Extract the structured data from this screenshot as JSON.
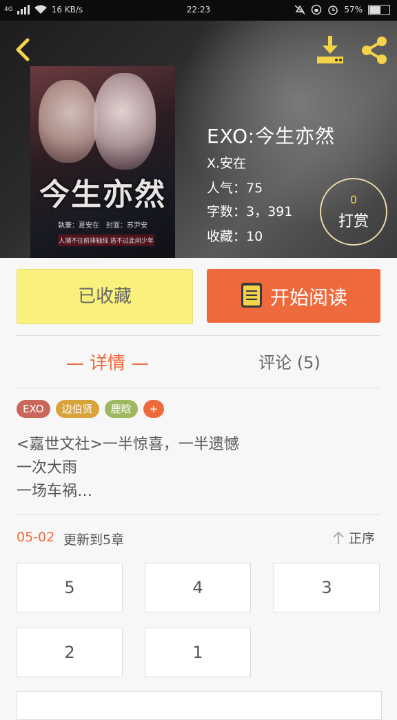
{
  "status_bar": {
    "network": "4G",
    "speed": "16 KB/s",
    "time": "22:23",
    "battery": "57%"
  },
  "header": {
    "back_icon": "chevron-left-icon",
    "download_icon": "download-icon",
    "share_icon": "share-icon",
    "accent_color": "#f3d34a"
  },
  "book": {
    "cover_title": "今生亦然",
    "cover_credit": "執筆：夏安在　封面：苏尹安",
    "cover_tagline": "人潮不往前排轴线  逃不过此间少年",
    "title": "EXO:今生亦然",
    "author": "X.安在",
    "popularity": "人气：75",
    "word_count": "字数：3，391",
    "favorites": "收藏：10",
    "tip": {
      "count": "0",
      "label": "打赏"
    }
  },
  "actions": {
    "favorite_label": "已收藏",
    "read_label": "开始阅读",
    "favorite_color": "#faf17c",
    "read_color": "#ee6a3c"
  },
  "tabs": {
    "detail": "— 详情 —",
    "comments": "评论 (5)"
  },
  "tags": [
    {
      "label": "EXO",
      "color": "#c9675a"
    },
    {
      "label": "边伯贤",
      "color": "#d9a33c"
    },
    {
      "label": "鹿晗",
      "color": "#9fb760"
    },
    {
      "label": "+",
      "color": "#ee6a3c"
    }
  ],
  "description": [
    "<嘉世文社>一半惊喜，一半遗憾",
    "一次大雨",
    "一场车祸…"
  ],
  "chapters_header": {
    "date": "05-02",
    "update_text": "更新到5章",
    "sort_label": "正序"
  },
  "chapters": [
    "5",
    "4",
    "3",
    "2",
    "1"
  ]
}
